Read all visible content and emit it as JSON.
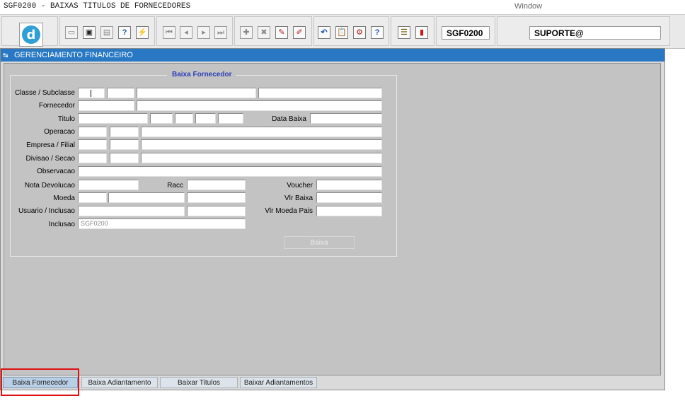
{
  "window": {
    "title": "SGF0200 - BAIXAS TITULOS DE FORNECEDORES",
    "menu": "Window"
  },
  "toolbar": {
    "logo_letter": "d",
    "module_code": "SGF0200",
    "user": "SUPORTE@",
    "glyphs": {
      "save": "▭",
      "window": "▣",
      "print": "▤",
      "help_query": "?",
      "execute": "⚡",
      "first": "⏮",
      "prev": "◂",
      "next": "▸",
      "last": "⏭",
      "insert": "✚",
      "delete": "✖",
      "edit": "✎",
      "clear": "✐",
      "undo": "↶",
      "copy": "📋",
      "tools": "⚙",
      "help": "?",
      "menu": "☰",
      "exit": "▮"
    }
  },
  "main": {
    "header_icon": "↹",
    "header_title": "GERENCIAMENTO FINANCEIRO"
  },
  "form": {
    "frame_title": "Baixa Fornecedor",
    "labels": {
      "classe": "Classe / Subclasse",
      "fornecedor": "Fornecedor",
      "titulo": "Titulo",
      "data_baixa": "Data Baixa",
      "operacao": "Operacao",
      "empresa": "Empresa / Filial",
      "divisao": "Divisao / Secao",
      "observacao": "Observacao",
      "nota_devolucao": "Nota Devolucao",
      "racc": "Racc",
      "voucher": "Voucher",
      "moeda": "Moeda",
      "vlr_baixa": "Vlr Baixa",
      "usuario": "Usuario / Inclusao",
      "vlr_moeda_pais": "Vlr Moeda Pais",
      "inclusao": "Inclusao"
    },
    "inclusao_value": "SGF0200",
    "button_baixa": "Baixa"
  },
  "tabs": [
    {
      "label": "Baixa Fornecedor",
      "active": true
    },
    {
      "label": "Baixa Adiantamento",
      "active": false
    },
    {
      "label": "Baixar Titulos",
      "active": false
    },
    {
      "label": "Baixar Adiantamentos",
      "active": false
    }
  ],
  "colors": {
    "header_blue": "#2878c3",
    "frame_title": "#2b3db6",
    "highlight_red": "#e01010"
  }
}
